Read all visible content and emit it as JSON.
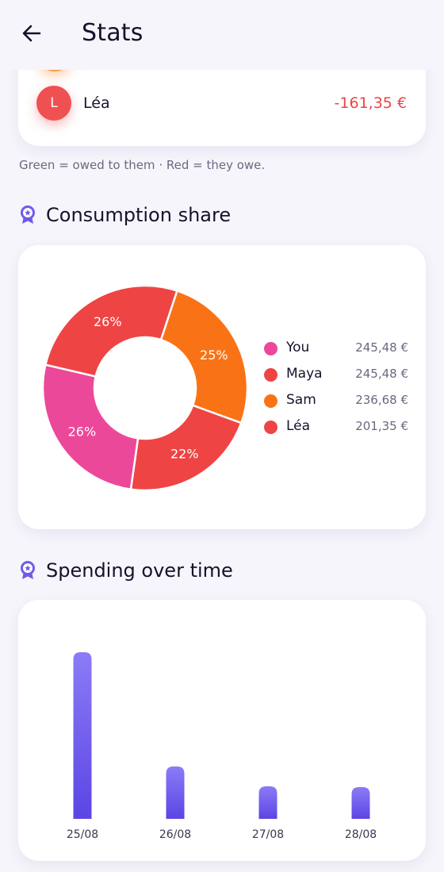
{
  "header": {
    "title": "Stats"
  },
  "balances": {
    "members": [
      {
        "initial": "",
        "name": "",
        "amount": "",
        "color": "#f59a43"
      },
      {
        "initial": "L",
        "name": "Léa",
        "amount": "-161,35 €",
        "color": "#ef4444"
      }
    ],
    "hint": "Green = owed to them · Red = they owe."
  },
  "consumption": {
    "title": "Consumption share",
    "legend": [
      {
        "name": "You",
        "value": "245,48 €",
        "color": "#ec4899"
      },
      {
        "name": "Maya",
        "value": "245,48 €",
        "color": "#ef4444"
      },
      {
        "name": "Sam",
        "value": "236,68 €",
        "color": "#f97316"
      },
      {
        "name": "Léa",
        "value": "201,35 €",
        "color": "#ef4444"
      }
    ]
  },
  "spending": {
    "title": "Spending over time"
  },
  "chart_data": [
    {
      "type": "pie",
      "title": "Consumption share",
      "categories": [
        "You",
        "Maya",
        "Sam",
        "Léa"
      ],
      "values": [
        245.48,
        245.48,
        236.68,
        201.35
      ],
      "labels": [
        "26%",
        "26%",
        "25%",
        "22%"
      ],
      "colors": [
        "#ec4899",
        "#ef4444",
        "#f97316",
        "#ef4444"
      ],
      "donut": true
    },
    {
      "type": "bar",
      "title": "Spending over time",
      "categories": [
        "25/08",
        "26/08",
        "27/08",
        "28/08"
      ],
      "values": [
        210,
        66,
        41,
        40
      ],
      "grid": false
    }
  ]
}
